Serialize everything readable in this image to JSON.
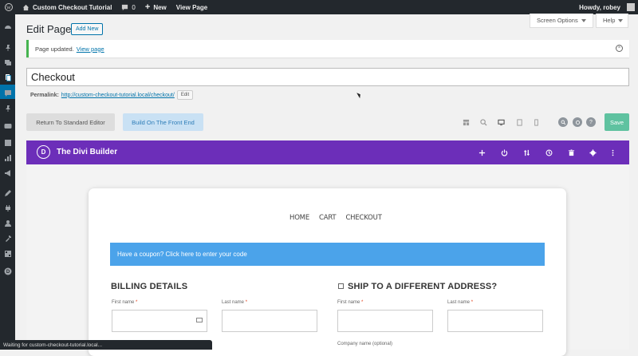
{
  "admin_bar": {
    "site_name": "Custom Checkout Tutorial",
    "comments_count": "0",
    "new_label": "New",
    "view_page_label": "View Page",
    "greeting": "Howdy, robey"
  },
  "header": {
    "title": "Edit Page",
    "add_new_label": "Add New",
    "screen_options_label": "Screen Options",
    "help_label": "Help"
  },
  "notice": {
    "text": "Page updated.",
    "link_label": "View page"
  },
  "post": {
    "title_value": "Checkout",
    "permalink_label": "Permalink:",
    "permalink_url": "http://custom-checkout-tutorial.local/checkout/",
    "edit_label": "Edit"
  },
  "builder_toolbar": {
    "return_label": "Return To Standard Editor",
    "front_end_label": "Build On The Front End",
    "save_label": "Save"
  },
  "divi": {
    "logo_letter": "D",
    "title": "The Divi Builder"
  },
  "preview": {
    "nav": [
      "HOME",
      "CART",
      "CHECKOUT"
    ],
    "coupon_text": "Have a coupon? Click here to enter your code",
    "billing_heading": "BILLING DETAILS",
    "shipping_heading": "SHIP TO A DIFFERENT ADDRESS?",
    "first_name_label": "First name",
    "last_name_label": "Last name",
    "required_marker": "*",
    "company_label": "Company name (optional)"
  },
  "status_bar": {
    "text": "Waiting for custom-checkout-tutorial.local..."
  },
  "colors": {
    "admin_dark": "#23282d",
    "wp_blue": "#0073aa",
    "divi_purple": "#6c2eb9",
    "coupon_blue": "#4ba3ea",
    "save_green": "#5fc2a0",
    "notice_green": "#46b450"
  }
}
